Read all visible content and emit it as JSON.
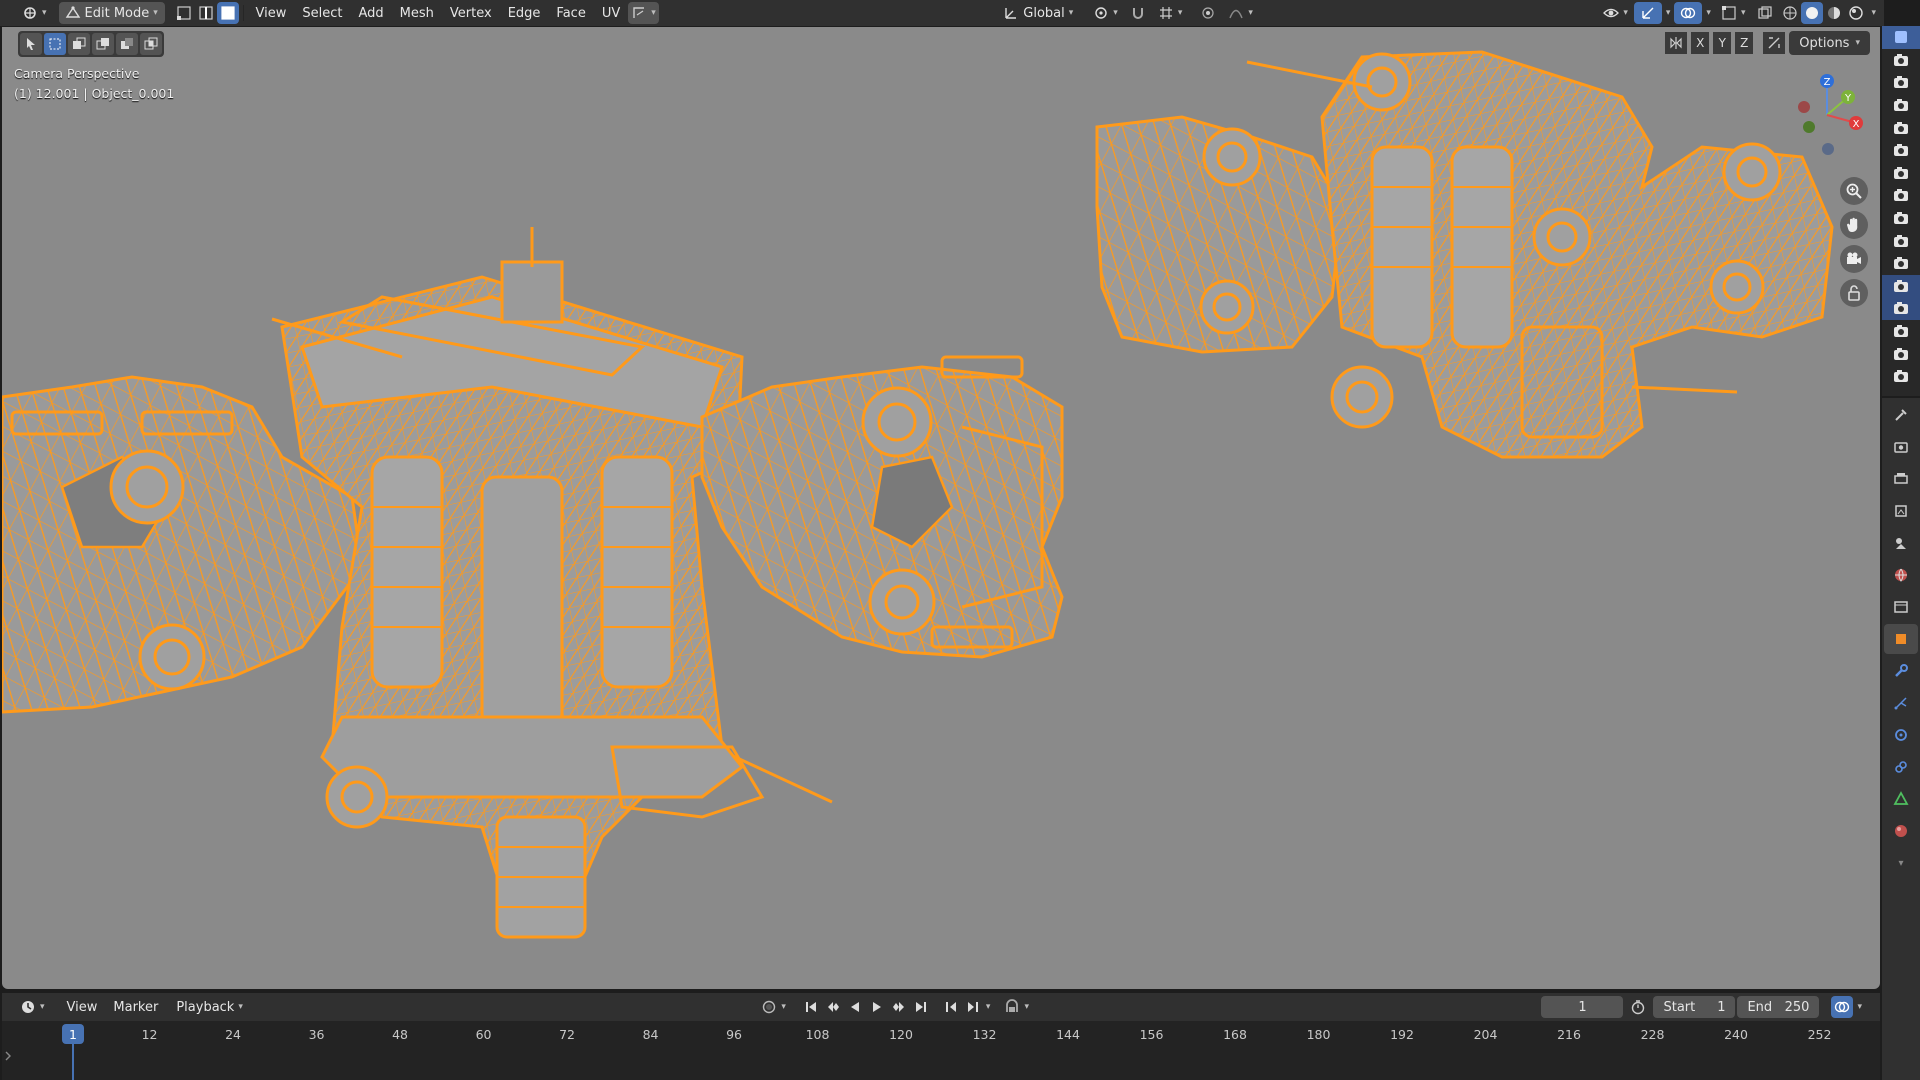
{
  "header": {
    "mode": "Edit Mode",
    "menus": [
      "View",
      "Select",
      "Add",
      "Mesh",
      "Vertex",
      "Edge",
      "Face",
      "UV"
    ],
    "orientation": "Global"
  },
  "viewport": {
    "camera_label": "Camera Perspective",
    "object_label": "(1) 12.001 | Object_0.001",
    "axes": [
      "X",
      "Y",
      "Z"
    ],
    "options_label": "Options",
    "gizmo": {
      "x": "X",
      "y": "Y",
      "z": "Z"
    },
    "colors": {
      "background": "#8a8a8a",
      "mesh": "#ff9a1a",
      "surface": "#9c9c9c"
    }
  },
  "timeline": {
    "menus": [
      "View",
      "Marker",
      "Playback"
    ],
    "current_frame": "1",
    "start_label": "Start",
    "start_value": "1",
    "end_label": "End",
    "end_value": "250",
    "ruler": [
      "12",
      "24",
      "36",
      "48",
      "60",
      "72",
      "84",
      "96",
      "108",
      "120",
      "132",
      "144",
      "156",
      "168",
      "180",
      "192",
      "204",
      "216",
      "228",
      "240",
      "252"
    ],
    "playhead": "1"
  },
  "icons": {
    "editor_type": "editor-type-icon",
    "object": "camera-icon",
    "outliner_row": "camera-data-icon"
  },
  "accent": "#4772b3"
}
